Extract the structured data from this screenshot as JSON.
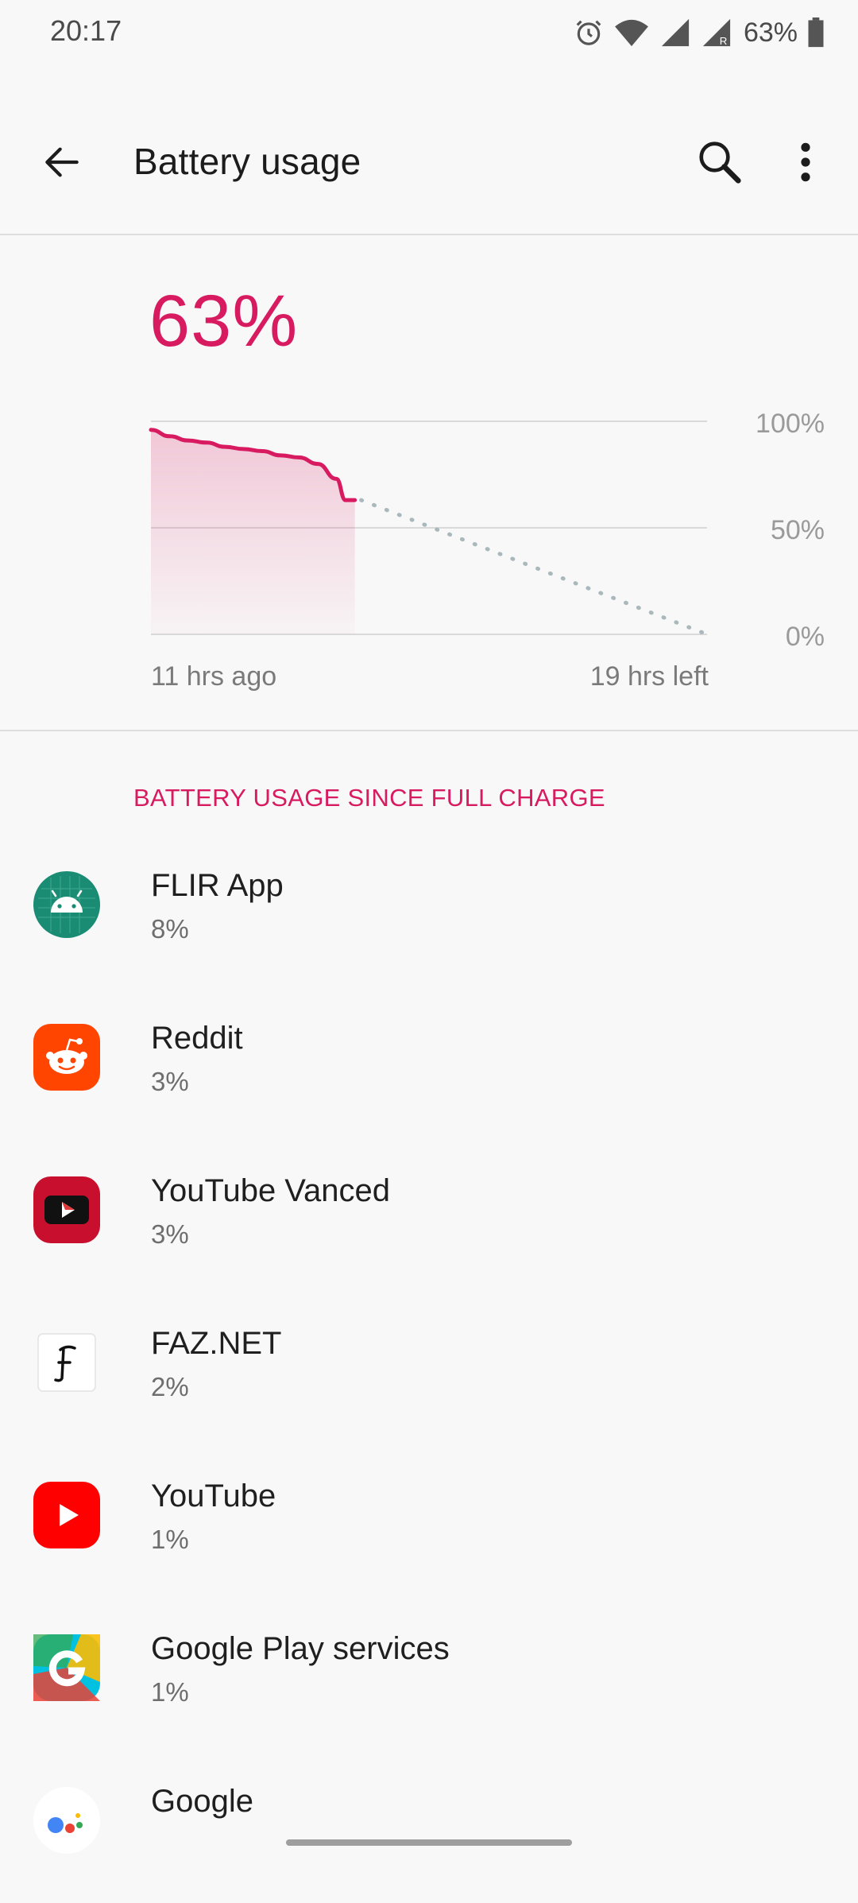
{
  "status_bar": {
    "time": "20:17",
    "battery_percent": "63%",
    "icons": [
      "alarm-icon",
      "wifi-icon",
      "signal-icon",
      "signal-roaming-icon",
      "battery-icon"
    ]
  },
  "app_bar": {
    "title": "Battery usage",
    "back_icon": "arrow-back-icon",
    "search_icon": "search-icon",
    "more_icon": "more-vert-icon"
  },
  "battery": {
    "level": "63%",
    "accent_color": "#d81b60"
  },
  "chart_data": {
    "type": "line",
    "y_ticks": [
      "100%",
      "50%",
      "0%"
    ],
    "x_start_label": "11 hrs ago",
    "x_end_label": "19 hrs left",
    "ylim": [
      0,
      100
    ],
    "history_hours": [
      0,
      1,
      2,
      3,
      4,
      5,
      6,
      7,
      8,
      9,
      10,
      10.5,
      11
    ],
    "history_values": [
      96,
      93,
      91,
      90,
      88,
      87,
      86,
      84,
      83,
      80,
      73,
      63,
      63
    ],
    "projection_hours": [
      11,
      30
    ],
    "projection_values": [
      63,
      0
    ],
    "total_hours": 30,
    "line_color": "#d81b60",
    "projection_color": "#a9b8bc"
  },
  "section": {
    "header": "BATTERY USAGE SINCE FULL CHARGE"
  },
  "apps": [
    {
      "name": "FLIR App",
      "usage": "8%",
      "icon": "android-icon"
    },
    {
      "name": "Reddit",
      "usage": "3%",
      "icon": "reddit-icon"
    },
    {
      "name": "YouTube Vanced",
      "usage": "3%",
      "icon": "youtube-vanced-icon"
    },
    {
      "name": "FAZ.NET",
      "usage": "2%",
      "icon": "faz-icon"
    },
    {
      "name": "YouTube",
      "usage": "1%",
      "icon": "youtube-icon"
    },
    {
      "name": "Google Play services",
      "usage": "1%",
      "icon": "google-play-services-icon"
    },
    {
      "name": "Google",
      "usage": "",
      "icon": "google-icon"
    }
  ]
}
